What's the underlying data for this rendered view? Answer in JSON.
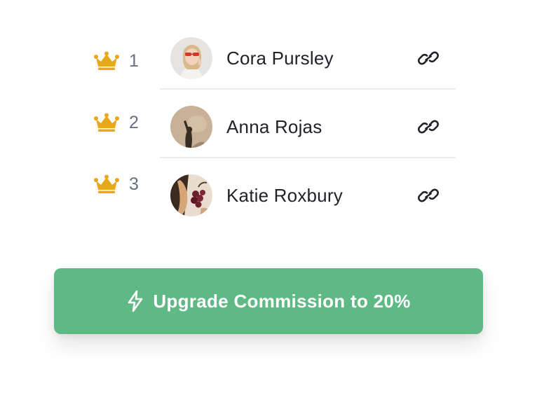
{
  "leaderboard": {
    "entries": [
      {
        "rank": "1",
        "name": "Cora Pursley"
      },
      {
        "rank": "2",
        "name": "Anna Rojas"
      },
      {
        "rank": "3",
        "name": "Katie Roxbury"
      }
    ]
  },
  "icons": {
    "rank": "crown-icon",
    "link": "link-icon",
    "upgrade": "lightning-bolt-icon"
  },
  "colors": {
    "crown": "#e8a817",
    "cta_background": "#5fb985",
    "cta_text": "#ffffff",
    "rank_text": "#667085",
    "name_text": "#1f2329"
  },
  "cta": {
    "label": "Upgrade Commission to 20%"
  }
}
